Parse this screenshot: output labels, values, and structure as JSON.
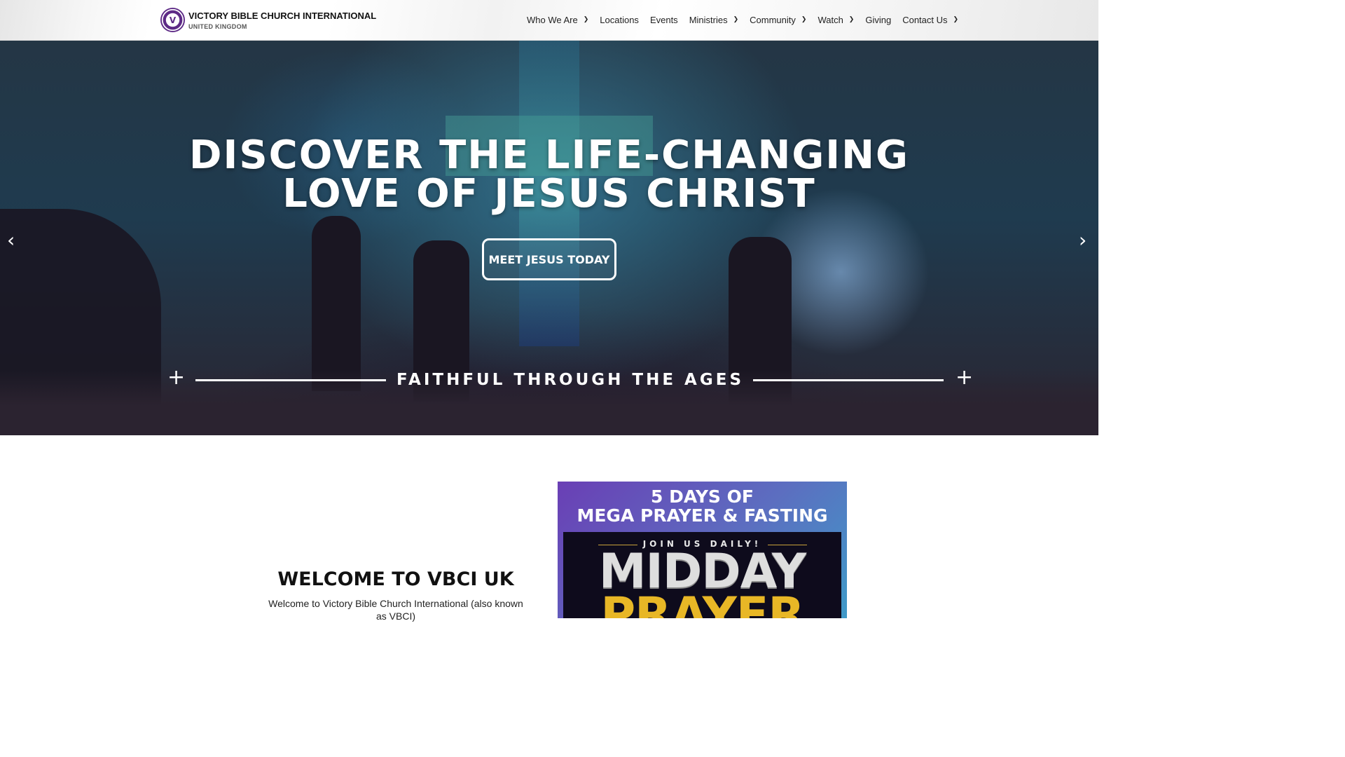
{
  "header": {
    "logo_title": "VICTORY BIBLE CHURCH INTERNATIONAL",
    "logo_subtitle": "UNITED KINGDOM",
    "nav": [
      {
        "label": "Who We Are",
        "has_dropdown": true
      },
      {
        "label": "Locations",
        "has_dropdown": false
      },
      {
        "label": "Events",
        "has_dropdown": false
      },
      {
        "label": "Ministries",
        "has_dropdown": true
      },
      {
        "label": "Community",
        "has_dropdown": true
      },
      {
        "label": "Watch",
        "has_dropdown": true
      },
      {
        "label": "Giving",
        "has_dropdown": false
      },
      {
        "label": "Contact Us",
        "has_dropdown": true
      }
    ]
  },
  "hero": {
    "title_line1": "DISCOVER THE LIFE-CHANGING",
    "title_line2": "LOVE OF JESUS CHRIST",
    "cta_label": "MEET JESUS TODAY",
    "tagline": "FAITHFUL THROUGH THE AGES",
    "prev_icon": "chevron-left-icon",
    "next_icon": "chevron-right-icon"
  },
  "welcome": {
    "title": "WELCOME TO VBCI UK",
    "text": "Welcome to Victory Bible Church International (also known as VBCI)"
  },
  "promo": {
    "heading_line1": "5 DAYS OF",
    "heading_line2": "MEGA PRAYER & FASTING",
    "join_text": "JOIN US DAILY!",
    "big_line1": "MIDDAY",
    "big_line2": "PRAYER"
  },
  "colors": {
    "brand_purple": "#5d2a86",
    "promo_gold": "#e8b726",
    "hero_text": "#ffffff"
  }
}
